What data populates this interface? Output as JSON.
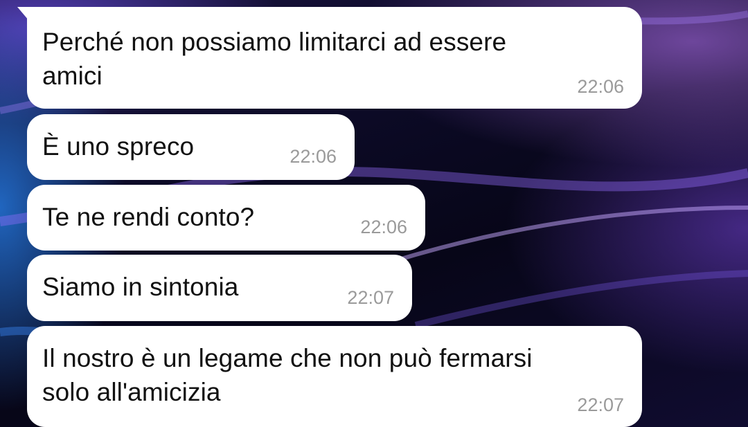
{
  "colors": {
    "bubble_background": "#ffffff",
    "message_text": "#111111",
    "timestamp_text": "#9a9a9a",
    "wallpaper_dark": "#070618",
    "wallpaper_glow_purple": "#be78ff",
    "wallpaper_glow_blue": "#288cff"
  },
  "messages": [
    {
      "text": "Perché non possiamo limitarci ad essere\namici",
      "time": "22:06"
    },
    {
      "text": "È uno spreco",
      "time": "22:06"
    },
    {
      "text": "Te ne rendi conto?",
      "time": "22:06"
    },
    {
      "text": "Siamo in sintonia",
      "time": "22:07"
    },
    {
      "text": "Il nostro è un legame che non può fermarsi\nsolo all'amicizia",
      "time": "22:07"
    }
  ]
}
